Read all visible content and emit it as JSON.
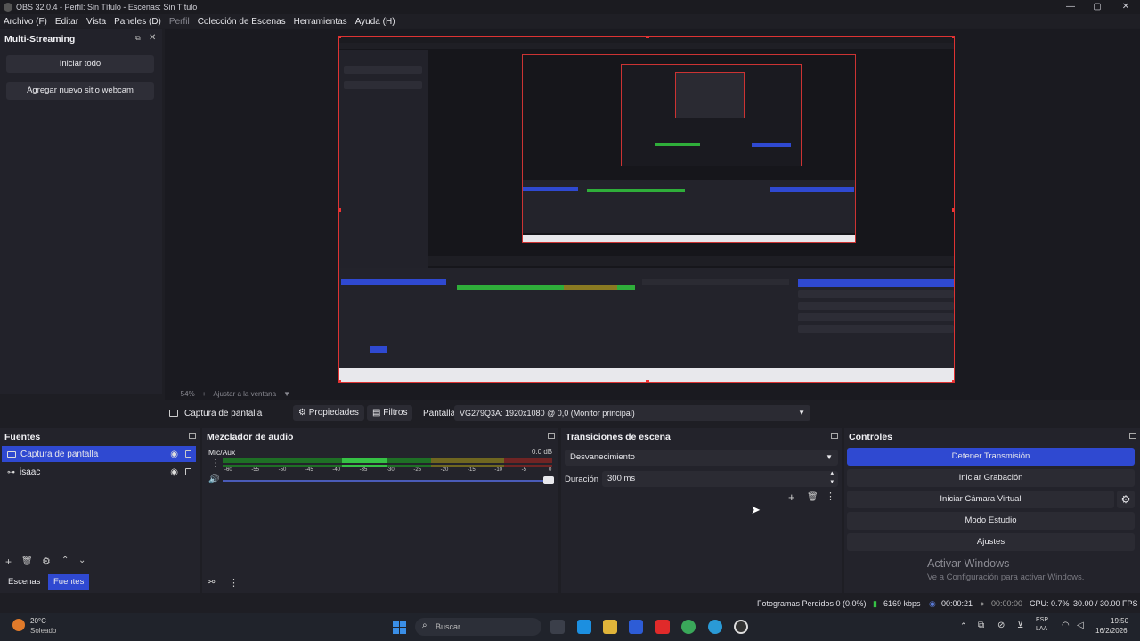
{
  "window": {
    "title": "OBS 32.0.4 - Perfil: Sin Título - Escenas: Sin Título"
  },
  "menu": [
    {
      "label": "Archivo (F)"
    },
    {
      "label": "Editar"
    },
    {
      "label": "Vista"
    },
    {
      "label": "Paneles (D)"
    },
    {
      "label": "Perfil"
    },
    {
      "label": "Colección de Escenas"
    },
    {
      "label": "Herramientas"
    },
    {
      "label": "Ayuda (H)"
    }
  ],
  "multistream": {
    "title": "Multi-Streaming",
    "start_all": "Iniciar todo",
    "add_webcam": "Agregar nuevo sitio webcam"
  },
  "preview": {
    "zoom": "54%",
    "fit_label": "Ajustar a la ventana"
  },
  "source_toolbar": {
    "source_name": "Captura de pantalla",
    "properties": "Propiedades",
    "filters": "Filtros",
    "display_label": "Pantalla",
    "display_value": "VG279Q3A: 1920x1080 @ 0,0 (Monitor principal)"
  },
  "sources": {
    "title": "Fuentes",
    "items": [
      {
        "name": "Captura de pantalla",
        "selected": true
      },
      {
        "name": "isaac",
        "selected": false
      }
    ],
    "tabs": [
      "Escenas",
      "Fuentes"
    ]
  },
  "mixer": {
    "title": "Mezclador de audio",
    "channel": "Mic/Aux",
    "level": "0.0 dB",
    "ticks": [
      "-60",
      "-55",
      "-50",
      "-45",
      "-40",
      "-35",
      "-30",
      "-25",
      "-20",
      "-15",
      "-10",
      "-5",
      "0"
    ]
  },
  "transitions": {
    "title": "Transiciones de escena",
    "selected": "Desvanecimiento",
    "duration_label": "Duración",
    "duration_value": "300 ms"
  },
  "controls": {
    "title": "Controles",
    "stop_stream": "Detener Transmisión",
    "start_recording": "Iniciar Grabación",
    "start_virtual_cam": "Iniciar Cámara Virtual",
    "studio_mode": "Modo Estudio",
    "settings": "Ajustes"
  },
  "watermark": {
    "line1": "Activar Windows",
    "line2": "Ve a Configuración para activar Windows."
  },
  "status": {
    "dropped_frames": "Fotogramas Perdidos 0 (0.0%)",
    "bitrate": "6169 kbps",
    "stream_time": "00:00:21",
    "record_time": "00:00:00",
    "cpu": "CPU: 0.7%",
    "fps": "30.00 / 30.00 FPS"
  },
  "taskbar": {
    "weather_temp": "20°C",
    "weather_desc": "Soleado",
    "search_placeholder": "Buscar",
    "lang_1": "ESP",
    "lang_2": "LAA",
    "time": "19:50",
    "date": "16/2/2026"
  },
  "colors": {
    "accent_blue": "#2f49d1",
    "preview_border": "#dd3333",
    "meter_green": "#2fae3a",
    "meter_yellow": "#8a7a22",
    "meter_red": "#8a2a2a"
  }
}
